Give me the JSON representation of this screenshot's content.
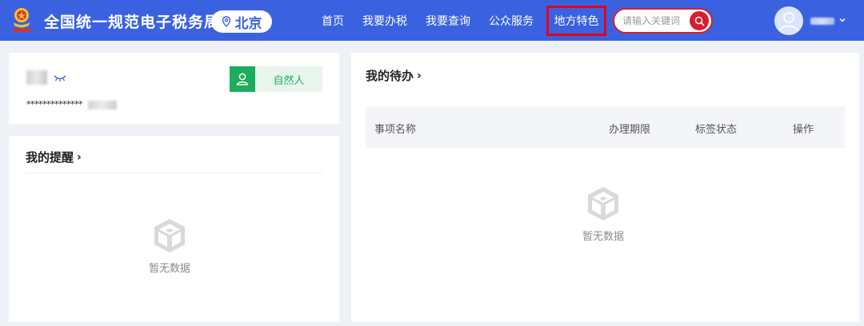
{
  "header": {
    "site_title": "全国统一规范电子税务局",
    "region": "北京",
    "nav": [
      {
        "label": "首页"
      },
      {
        "label": "我要办税"
      },
      {
        "label": "我要查询"
      },
      {
        "label": "公众服务"
      },
      {
        "label": "地方特色"
      }
    ],
    "search_placeholder": "请输入关键词"
  },
  "profile": {
    "masked_id": "**************",
    "role": "自然人"
  },
  "reminders": {
    "title": "我的提醒",
    "empty_text": "暂无数据"
  },
  "todo": {
    "title": "我的待办",
    "columns": [
      "事项名称",
      "办理期限",
      "标签状态",
      "操作"
    ],
    "empty_text": "暂无数据"
  },
  "colors": {
    "header_bg": "#3a62e0",
    "highlight_border": "#e60012",
    "search_accent": "#d81e2c",
    "role_green": "#1aad5b"
  }
}
